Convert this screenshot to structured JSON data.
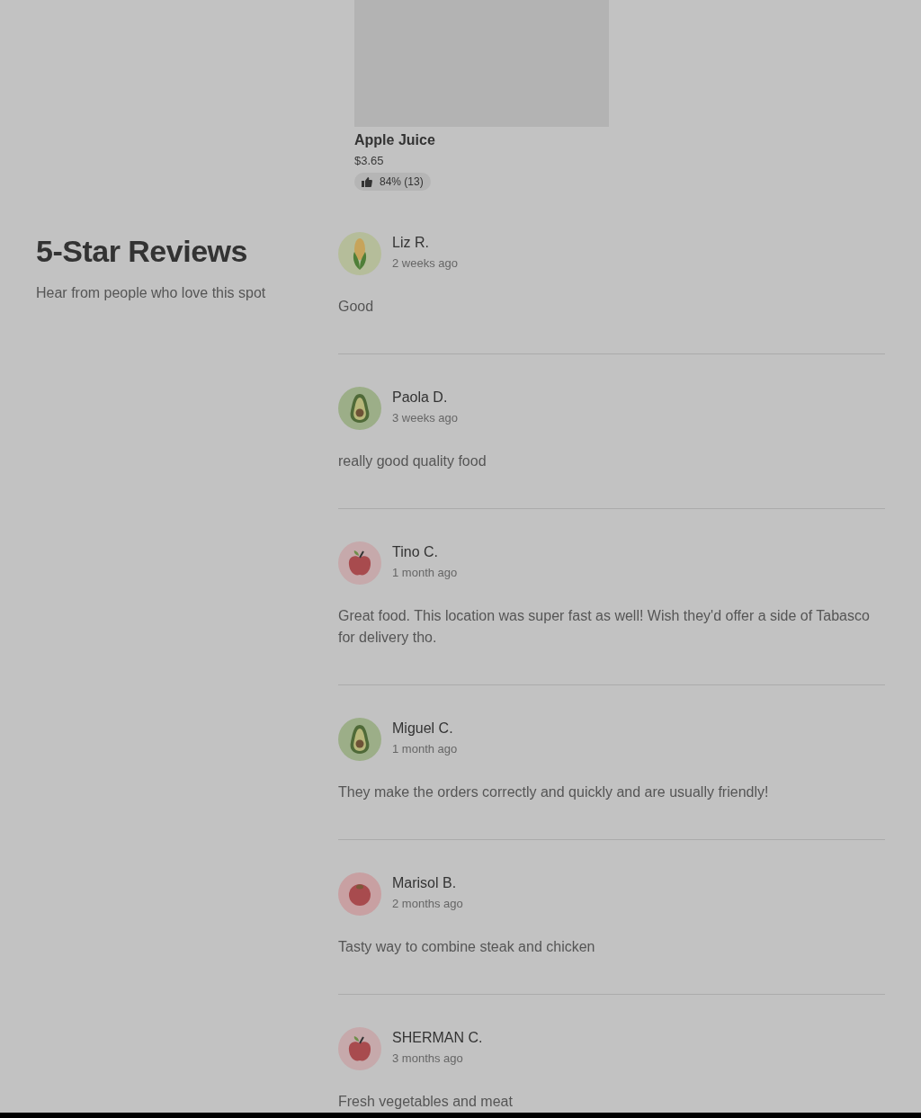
{
  "product": {
    "name": "Apple Juice",
    "price": "$3.65",
    "rating": "84% (13)"
  },
  "reviews_section": {
    "title": "5-Star Reviews",
    "subtitle": "Hear from people who love this spot"
  },
  "reviews": [
    {
      "name": "Liz R.",
      "date": "2 weeks ago",
      "text": "Good",
      "kind": "corn"
    },
    {
      "name": "Paola D.",
      "date": "3 weeks ago",
      "text": "really good quality food",
      "kind": "avocado"
    },
    {
      "name": "Tino C.",
      "date": "1 month ago",
      "text": "Great food. This location was super fast as well! Wish they'd offer a side of Tabasco for delivery tho.",
      "kind": "apple"
    },
    {
      "name": "Miguel C.",
      "date": "1 month ago",
      "text": "They make the orders correctly and quickly and are usually friendly!",
      "kind": "avocado"
    },
    {
      "name": "Marisol B.",
      "date": "2 months ago",
      "text": "Tasty way to combine steak and chicken",
      "kind": "tomato"
    },
    {
      "name": "SHERMAN C.",
      "date": "3 months ago",
      "text": "Fresh vegetables and meat",
      "kind": "apple"
    }
  ]
}
